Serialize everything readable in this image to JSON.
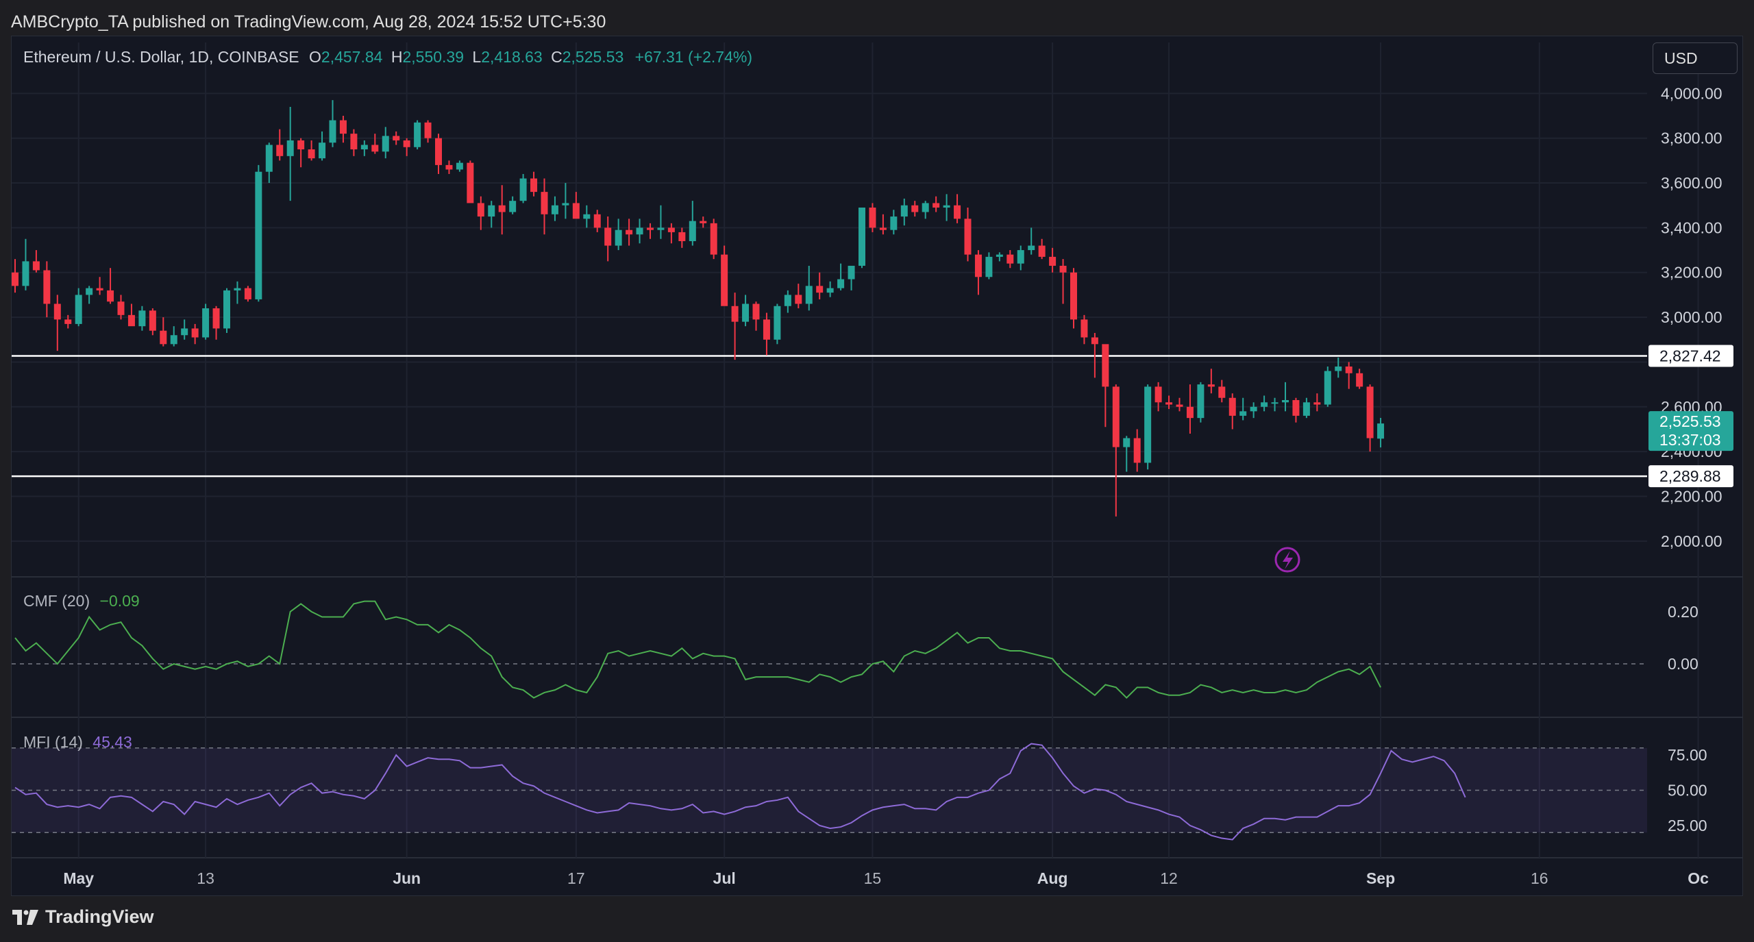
{
  "header": {
    "publish_text": "AMBCrypto_TA published on TradingView.com, Aug 28, 2024 15:52 UTC+5:30"
  },
  "legend": {
    "symbol": "Ethereum / U.S. Dollar, 1D, COINBASE",
    "o_label": "O",
    "o_value": "2,457.84",
    "h_label": "H",
    "h_value": "2,550.39",
    "l_label": "L",
    "l_value": "2,418.63",
    "c_label": "C",
    "c_value": "2,525.53",
    "change": "+67.31 (+2.74%)"
  },
  "currency_button": "USD",
  "footer": {
    "brand": "TradingView"
  },
  "colors": {
    "up": "#26a69a",
    "down": "#f23645",
    "cmf": "#4caf50",
    "mfi": "#8e6bd8",
    "bg": "#141722"
  },
  "chart_data": {
    "type": "candlestick",
    "title": "Ethereum / U.S. Dollar, 1D, COINBASE",
    "y_axis": {
      "ticks": [
        "4,000.00",
        "3,800.00",
        "3,600.00",
        "3,400.00",
        "3,200.00",
        "3,000.00",
        "2,600.00",
        "2,400.00",
        "2,200.00",
        "2,000.00"
      ],
      "ylim": [
        1920,
        4050
      ]
    },
    "x_axis": {
      "ticks": [
        "May",
        "13",
        "Jun",
        "17",
        "Jul",
        "15",
        "Aug",
        "12",
        "Sep",
        "16",
        "Oc"
      ]
    },
    "horizontal_levels": [
      {
        "label": "2,827.42",
        "value": 2827.42
      },
      {
        "label": "2,289.88",
        "value": 2289.88
      }
    ],
    "last_price": {
      "price": "2,525.53",
      "countdown": "13:37:03",
      "value": 2525.53
    },
    "start_date": "2024-04-25",
    "candles": [
      [
        3200,
        3260,
        3110,
        3140
      ],
      [
        3140,
        3350,
        3120,
        3250
      ],
      [
        3250,
        3300,
        3200,
        3210
      ],
      [
        3210,
        3250,
        3000,
        3060
      ],
      [
        3060,
        3100,
        2850,
        2990
      ],
      [
        2990,
        3010,
        2950,
        2970
      ],
      [
        2970,
        3130,
        2960,
        3100
      ],
      [
        3100,
        3140,
        3060,
        3130
      ],
      [
        3130,
        3180,
        3100,
        3120
      ],
      [
        3120,
        3220,
        3060,
        3070
      ],
      [
        3070,
        3100,
        2990,
        3010
      ],
      [
        3010,
        3060,
        2980,
        2960
      ],
      [
        2960,
        3050,
        2940,
        3030
      ],
      [
        3030,
        3040,
        2920,
        2940
      ],
      [
        2940,
        3000,
        2870,
        2880
      ],
      [
        2880,
        2960,
        2870,
        2920
      ],
      [
        2920,
        2990,
        2900,
        2950
      ],
      [
        2950,
        2970,
        2880,
        2910
      ],
      [
        2910,
        3060,
        2900,
        3040
      ],
      [
        3040,
        3050,
        2900,
        2950
      ],
      [
        2950,
        3130,
        2930,
        3120
      ],
      [
        3120,
        3160,
        3060,
        3130
      ],
      [
        3130,
        3140,
        3070,
        3080
      ],
      [
        3080,
        3680,
        3070,
        3650
      ],
      [
        3650,
        3780,
        3600,
        3770
      ],
      [
        3770,
        3840,
        3700,
        3720
      ],
      [
        3720,
        3940,
        3520,
        3790
      ],
      [
        3790,
        3800,
        3670,
        3750
      ],
      [
        3750,
        3790,
        3700,
        3710
      ],
      [
        3710,
        3830,
        3700,
        3780
      ],
      [
        3780,
        3970,
        3760,
        3880
      ],
      [
        3880,
        3900,
        3780,
        3820
      ],
      [
        3820,
        3840,
        3720,
        3750
      ],
      [
        3750,
        3790,
        3720,
        3770
      ],
      [
        3770,
        3820,
        3730,
        3740
      ],
      [
        3740,
        3850,
        3710,
        3810
      ],
      [
        3810,
        3830,
        3770,
        3790
      ],
      [
        3790,
        3800,
        3720,
        3760
      ],
      [
        3760,
        3880,
        3750,
        3870
      ],
      [
        3870,
        3880,
        3780,
        3800
      ],
      [
        3800,
        3820,
        3640,
        3680
      ],
      [
        3680,
        3700,
        3640,
        3660
      ],
      [
        3660,
        3700,
        3650,
        3690
      ],
      [
        3690,
        3700,
        3600,
        3510
      ],
      [
        3510,
        3540,
        3390,
        3450
      ],
      [
        3450,
        3520,
        3400,
        3500
      ],
      [
        3500,
        3590,
        3370,
        3470
      ],
      [
        3470,
        3540,
        3460,
        3520
      ],
      [
        3520,
        3640,
        3510,
        3620
      ],
      [
        3620,
        3650,
        3540,
        3560
      ],
      [
        3560,
        3620,
        3370,
        3460
      ],
      [
        3460,
        3540,
        3430,
        3500
      ],
      [
        3500,
        3600,
        3440,
        3510
      ],
      [
        3510,
        3560,
        3470,
        3440
      ],
      [
        3440,
        3500,
        3400,
        3460
      ],
      [
        3460,
        3480,
        3380,
        3400
      ],
      [
        3400,
        3450,
        3250,
        3320
      ],
      [
        3320,
        3440,
        3300,
        3390
      ],
      [
        3390,
        3440,
        3320,
        3370
      ],
      [
        3370,
        3440,
        3330,
        3400
      ],
      [
        3400,
        3420,
        3350,
        3390
      ],
      [
        3390,
        3500,
        3350,
        3400
      ],
      [
        3400,
        3420,
        3330,
        3380
      ],
      [
        3380,
        3400,
        3310,
        3340
      ],
      [
        3340,
        3520,
        3320,
        3430
      ],
      [
        3430,
        3450,
        3400,
        3420
      ],
      [
        3420,
        3440,
        3260,
        3280
      ],
      [
        3280,
        3320,
        3060,
        3050
      ],
      [
        3050,
        3110,
        2810,
        2980
      ],
      [
        2980,
        3100,
        2960,
        3060
      ],
      [
        3060,
        3070,
        2940,
        2990
      ],
      [
        2990,
        3020,
        2830,
        2900
      ],
      [
        2900,
        3060,
        2880,
        3050
      ],
      [
        3050,
        3120,
        3020,
        3100
      ],
      [
        3100,
        3150,
        3040,
        3060
      ],
      [
        3060,
        3230,
        3030,
        3140
      ],
      [
        3140,
        3200,
        3080,
        3110
      ],
      [
        3110,
        3160,
        3090,
        3130
      ],
      [
        3130,
        3240,
        3120,
        3170
      ],
      [
        3170,
        3180,
        3120,
        3230
      ],
      [
        3230,
        3450,
        3220,
        3490
      ],
      [
        3490,
        3510,
        3380,
        3400
      ],
      [
        3400,
        3460,
        3370,
        3390
      ],
      [
        3390,
        3480,
        3370,
        3450
      ],
      [
        3450,
        3530,
        3410,
        3500
      ],
      [
        3500,
        3520,
        3450,
        3470
      ],
      [
        3470,
        3520,
        3440,
        3510
      ],
      [
        3510,
        3540,
        3470,
        3490
      ],
      [
        3490,
        3550,
        3430,
        3500
      ],
      [
        3500,
        3550,
        3420,
        3440
      ],
      [
        3440,
        3490,
        3250,
        3280
      ],
      [
        3280,
        3300,
        3100,
        3180
      ],
      [
        3180,
        3290,
        3170,
        3270
      ],
      [
        3270,
        3290,
        3250,
        3280
      ],
      [
        3280,
        3300,
        3220,
        3240
      ],
      [
        3240,
        3320,
        3210,
        3300
      ],
      [
        3300,
        3400,
        3280,
        3320
      ],
      [
        3320,
        3350,
        3260,
        3270
      ],
      [
        3270,
        3310,
        3200,
        3230
      ],
      [
        3230,
        3260,
        3060,
        3200
      ],
      [
        3200,
        3220,
        2950,
        2990
      ],
      [
        2990,
        3010,
        2880,
        2910
      ],
      [
        2910,
        2930,
        2730,
        2880
      ],
      [
        2880,
        2850,
        2510,
        2690
      ],
      [
        2690,
        2700,
        2110,
        2420
      ],
      [
        2420,
        2470,
        2310,
        2460
      ],
      [
        2460,
        2500,
        2310,
        2350
      ],
      [
        2350,
        2700,
        2320,
        2690
      ],
      [
        2690,
        2710,
        2580,
        2620
      ],
      [
        2620,
        2650,
        2590,
        2610
      ],
      [
        2610,
        2640,
        2580,
        2600
      ],
      [
        2600,
        2700,
        2480,
        2550
      ],
      [
        2550,
        2710,
        2530,
        2700
      ],
      [
        2700,
        2770,
        2660,
        2690
      ],
      [
        2690,
        2720,
        2620,
        2640
      ],
      [
        2640,
        2660,
        2500,
        2560
      ],
      [
        2560,
        2640,
        2540,
        2580
      ],
      [
        2580,
        2620,
        2550,
        2600
      ],
      [
        2600,
        2650,
        2580,
        2620
      ],
      [
        2620,
        2640,
        2580,
        2620
      ],
      [
        2620,
        2710,
        2580,
        2630
      ],
      [
        2630,
        2640,
        2530,
        2560
      ],
      [
        2560,
        2640,
        2550,
        2620
      ],
      [
        2620,
        2660,
        2580,
        2610
      ],
      [
        2610,
        2780,
        2600,
        2760
      ],
      [
        2760,
        2820,
        2730,
        2780
      ],
      [
        2780,
        2800,
        2680,
        2750
      ],
      [
        2750,
        2770,
        2680,
        2690
      ],
      [
        2690,
        2700,
        2400,
        2460
      ],
      [
        2457.84,
        2550.39,
        2418.63,
        2525.53
      ]
    ]
  },
  "cmf": {
    "name": "CMF (20)",
    "value": "−0.09",
    "ticks": [
      "0.20",
      "0.00"
    ],
    "ylim": [
      -0.16,
      0.26
    ],
    "values": [
      0.1,
      0.05,
      0.08,
      0.04,
      0.0,
      0.05,
      0.1,
      0.18,
      0.13,
      0.15,
      0.16,
      0.1,
      0.07,
      0.02,
      -0.02,
      0.0,
      -0.01,
      -0.02,
      -0.01,
      -0.02,
      0.0,
      0.01,
      -0.01,
      0.0,
      0.03,
      0.0,
      0.2,
      0.23,
      0.2,
      0.18,
      0.18,
      0.18,
      0.23,
      0.24,
      0.24,
      0.17,
      0.18,
      0.17,
      0.15,
      0.15,
      0.12,
      0.15,
      0.13,
      0.1,
      0.06,
      0.03,
      -0.05,
      -0.09,
      -0.1,
      -0.13,
      -0.11,
      -0.1,
      -0.08,
      -0.1,
      -0.11,
      -0.05,
      0.04,
      0.05,
      0.03,
      0.04,
      0.05,
      0.04,
      0.03,
      0.06,
      0.02,
      0.04,
      0.03,
      0.03,
      0.02,
      -0.06,
      -0.05,
      -0.05,
      -0.05,
      -0.05,
      -0.06,
      -0.07,
      -0.04,
      -0.05,
      -0.07,
      -0.05,
      -0.04,
      0.0,
      0.01,
      -0.03,
      0.03,
      0.05,
      0.04,
      0.06,
      0.09,
      0.12,
      0.08,
      0.1,
      0.1,
      0.06,
      0.05,
      0.05,
      0.04,
      0.03,
      0.02,
      -0.03,
      -0.06,
      -0.09,
      -0.12,
      -0.08,
      -0.09,
      -0.13,
      -0.09,
      -0.09,
      -0.11,
      -0.12,
      -0.12,
      -0.11,
      -0.08,
      -0.09,
      -0.11,
      -0.1,
      -0.11,
      -0.1,
      -0.11,
      -0.11,
      -0.1,
      -0.11,
      -0.1,
      -0.07,
      -0.05,
      -0.03,
      -0.02,
      -0.04,
      -0.01,
      -0.09
    ]
  },
  "mfi": {
    "name": "MFI (14)",
    "value": "45.43",
    "ticks": [
      "75.00",
      "50.00",
      "25.00"
    ],
    "ylim": [
      8,
      93
    ],
    "values": [
      52,
      47,
      48,
      40,
      38,
      39,
      38,
      40,
      37,
      45,
      46,
      45,
      40,
      35,
      42,
      40,
      33,
      42,
      40,
      38,
      44,
      40,
      43,
      45,
      48,
      39,
      47,
      52,
      55,
      48,
      49,
      47,
      46,
      44,
      50,
      62,
      75,
      67,
      70,
      73,
      72,
      72,
      71,
      66,
      66,
      67,
      68,
      60,
      55,
      53,
      48,
      45,
      42,
      39,
      36,
      34,
      35,
      36,
      41,
      40,
      39,
      37,
      36,
      37,
      40,
      34,
      35,
      33,
      35,
      38,
      39,
      42,
      43,
      45,
      35,
      30,
      25,
      23,
      24,
      27,
      32,
      36,
      38,
      39,
      40,
      37,
      37,
      36,
      42,
      45,
      45,
      48,
      50,
      58,
      62,
      78,
      83,
      82,
      73,
      62,
      53,
      48,
      51,
      50,
      47,
      42,
      40,
      38,
      36,
      33,
      31,
      25,
      22,
      18,
      16,
      15,
      23,
      26,
      30,
      30,
      29,
      31,
      31,
      31,
      35,
      39,
      39,
      41,
      47,
      62,
      78,
      72,
      70,
      72,
      74,
      71,
      62,
      45
    ]
  }
}
